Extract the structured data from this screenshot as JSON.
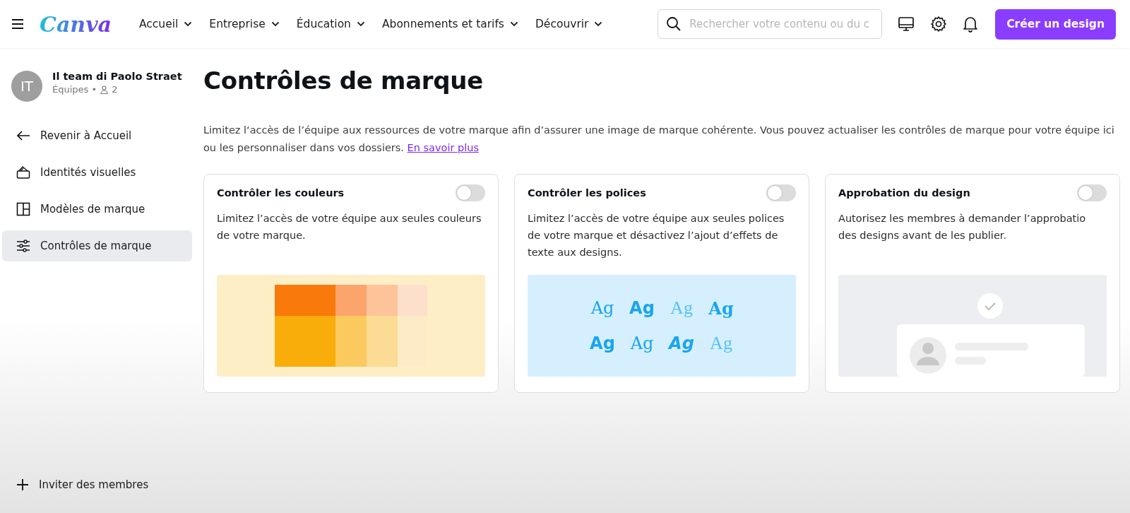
{
  "header": {
    "logo": "Canva",
    "nav": [
      {
        "label": "Accueil"
      },
      {
        "label": "Entreprise"
      },
      {
        "label": "Éducation"
      },
      {
        "label": "Abonnements et tarifs"
      },
      {
        "label": "Découvrir"
      }
    ],
    "search": {
      "placeholder": "Rechercher votre contenu ou du c"
    },
    "create_button": "Créer un design"
  },
  "sidebar": {
    "team": {
      "initials": "IT",
      "name": "Il team di Paolo Straet",
      "type": "Équipes •",
      "members": "2"
    },
    "items": [
      {
        "kind": "back",
        "label": "Revenir à Accueil",
        "selected": false
      },
      {
        "kind": "brand",
        "label": "Identités visuelles",
        "selected": false
      },
      {
        "kind": "templates",
        "label": "Modèles de marque",
        "selected": false
      },
      {
        "kind": "controls",
        "label": "Contrôles de marque",
        "selected": true
      }
    ],
    "invite": "Inviter des membres"
  },
  "main": {
    "title": "Contrôles de marque",
    "description": "Limitez l‘accès de l’équipe aux ressources de votre marque afin d’assurer une image de marque cohérente. Vous pouvez actualiser les contrôles de marque pour votre équipe ici ou les personnaliser dans vos dossiers.",
    "link": "En savoir plus",
    "cards": [
      {
        "kind": "colors",
        "title": "Contrôler les couleurs",
        "on": false,
        "text": "Limitez l’accès de votre équipe aux seules couleurs de votre marque."
      },
      {
        "kind": "fonts",
        "title": "Contrôler les polices",
        "on": false,
        "text": "Limitez l’accès de votre équipe aux seules polices de votre marque et désactivez l’ajout d’effets de texte aux designs.",
        "samples": [
          {
            "text": "Ag",
            "kind": "serif"
          },
          {
            "text": "Ag",
            "kind": "bold"
          },
          {
            "text": "Ag",
            "kind": "light"
          },
          {
            "text": "Ag",
            "kind": "slab"
          },
          {
            "text": "Ag",
            "kind": "bold"
          },
          {
            "text": "Ag",
            "kind": "serif"
          },
          {
            "text": "Ag",
            "kind": "italic"
          },
          {
            "text": "Ag",
            "kind": "light"
          }
        ]
      },
      {
        "kind": "approval",
        "title": "Approbation du design",
        "on": false,
        "text": "Autorisez les membres à demander l’approbatio des designs avant de les publier."
      }
    ]
  }
}
